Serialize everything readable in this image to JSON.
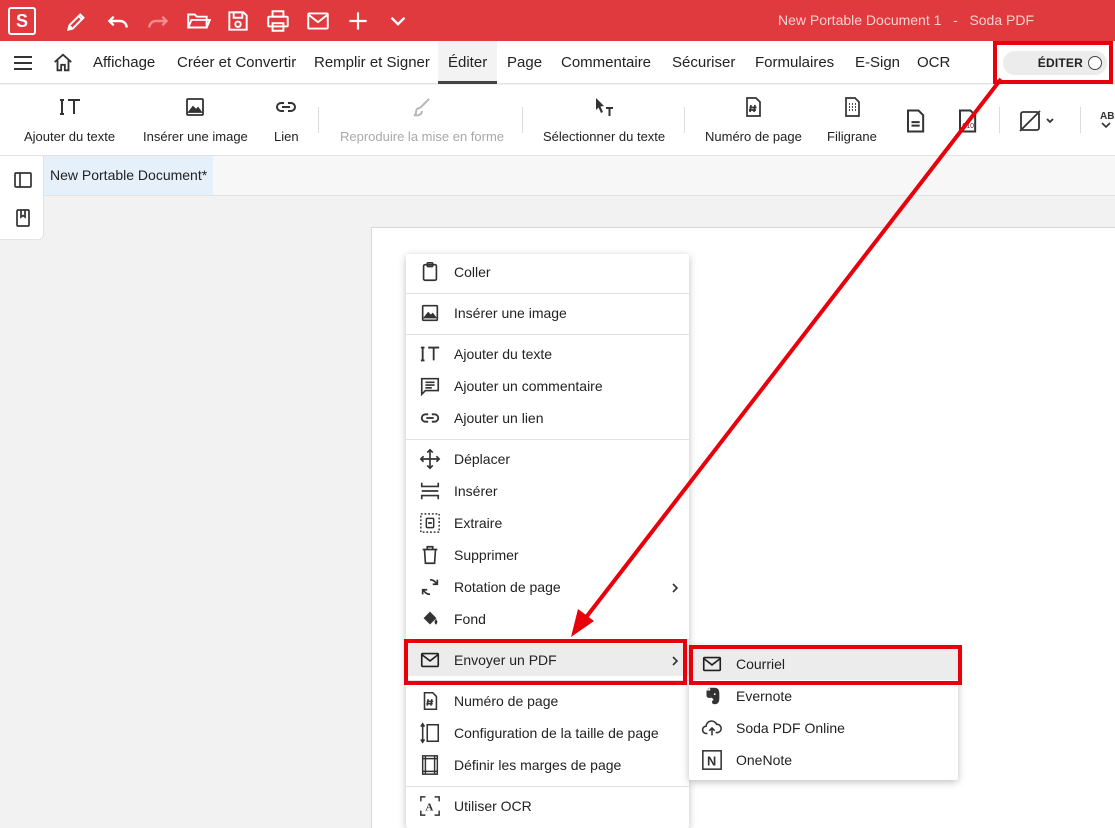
{
  "titlebar": {
    "logo": "S",
    "title": "New Portable Document 1",
    "separator": "-",
    "app_name": "Soda PDF",
    "quick_actions": [
      "pen-icon",
      "undo-icon",
      "redo-icon",
      "open-folder-icon",
      "save-icon",
      "print-icon",
      "mail-icon",
      "plus-icon",
      "chevron-down-icon"
    ],
    "accent_color": "#e0393e"
  },
  "menubar": {
    "items": [
      "Affichage",
      "Créer et Convertir",
      "Remplir et Signer",
      "Éditer",
      "Page",
      "Commentaire",
      "Sécuriser",
      "Formulaires",
      "E-Sign",
      "OCR"
    ],
    "active": "Éditer",
    "edit_toggle": "ÉDITER"
  },
  "ribbon": {
    "add_text": "Ajouter du texte",
    "insert_image": "Insérer une image",
    "link": "Lien",
    "copy_format": "Reproduire la mise en forme",
    "select_text": "Sélectionner du texte",
    "page_number": "Numéro de page",
    "watermark": "Filigrane"
  },
  "doc_tab": {
    "label": "New Portable Document*"
  },
  "context_menu": {
    "paste": "Coller",
    "insert_image": "Insérer une image",
    "add_text": "Ajouter du texte",
    "add_comment": "Ajouter un commentaire",
    "add_link": "Ajouter un lien",
    "move": "Déplacer",
    "insert": "Insérer",
    "extract": "Extraire",
    "delete": "Supprimer",
    "rotate": "Rotation de page",
    "background": "Fond",
    "send_pdf": "Envoyer un PDF",
    "page_number": "Numéro de page",
    "page_size": "Configuration de la taille de page",
    "page_margins": "Définir les marges de page",
    "ocr": "Utiliser OCR"
  },
  "submenu": {
    "email": "Courriel",
    "evernote": "Evernote",
    "soda_online": "Soda PDF Online",
    "onenote": "OneNote"
  },
  "annotation_color": "#e8000a"
}
